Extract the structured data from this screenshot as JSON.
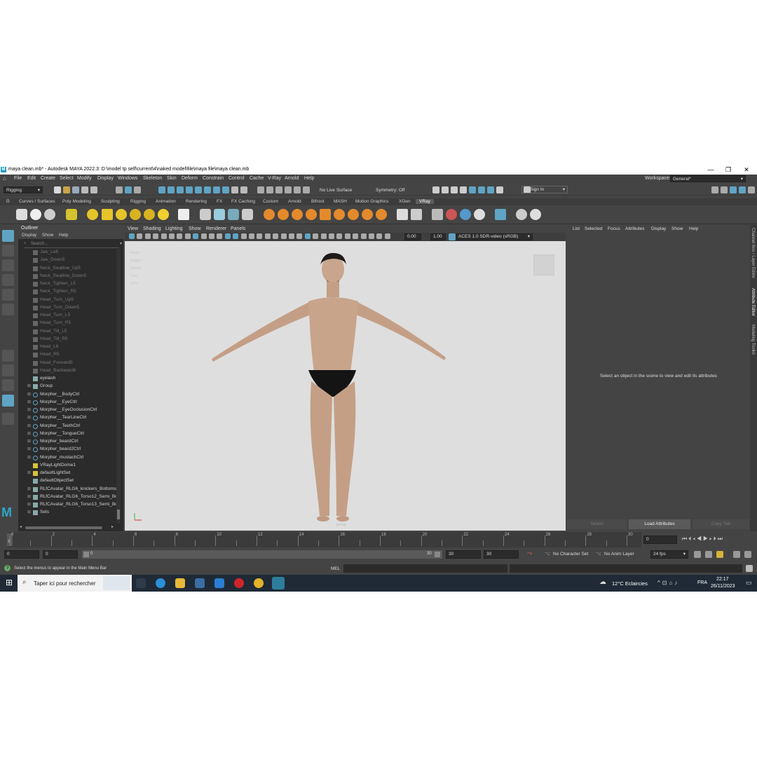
{
  "window": {
    "title": "maya clean.mb* - Autodesk MAYA 2022.3: D:\\model tp self\\current\\4\\naked model\\file\\maya file\\maya clean.mb",
    "logo_letter": "M",
    "minimize": "—",
    "restore": "❐",
    "close": "✕"
  },
  "menubar": {
    "items": [
      "File",
      "Edit",
      "Create",
      "Select",
      "Modify",
      "Display",
      "Windows",
      "Skeleton",
      "Skin",
      "Deform",
      "Constrain",
      "Control",
      "Cache",
      "V-Ray",
      "Arnold",
      "Help"
    ],
    "workspace_label": "Workspace:",
    "workspace_value": "General*"
  },
  "statusline": {
    "mode": "Rigging",
    "live_surface": "No Live Surface",
    "symmetry": "Symmetry: Off",
    "sign_in": "Sign In"
  },
  "shelf": {
    "tabs": [
      "Curves / Surfaces",
      "Poly Modeling",
      "Sculpting",
      "Rigging",
      "Animation",
      "Rendering",
      "FX",
      "FX Caching",
      "Custom",
      "Arnold",
      "Bifrost",
      "MASH",
      "Motion Graphics",
      "XGen",
      "VRay"
    ],
    "active_tab": "VRay"
  },
  "outliner": {
    "title": "Outliner",
    "menus": [
      "Display",
      "Show",
      "Help"
    ],
    "search_placeholder": "Search...",
    "items": [
      {
        "label": "Jaw_Left",
        "dim": true,
        "exp": false
      },
      {
        "label": "Jaw_Down5",
        "dim": true,
        "exp": false
      },
      {
        "label": "Neck_Swallow_Up5",
        "dim": true,
        "exp": false
      },
      {
        "label": "Neck_Swallow_Down5",
        "dim": true,
        "exp": false
      },
      {
        "label": "Neck_Tighten_L5",
        "dim": true,
        "exp": false
      },
      {
        "label": "Neck_Tighten_R5",
        "dim": true,
        "exp": false
      },
      {
        "label": "Head_Turn_Up5",
        "dim": true,
        "exp": false
      },
      {
        "label": "Head_Turn_Down5",
        "dim": true,
        "exp": false
      },
      {
        "label": "Head_Turn_L5",
        "dim": true,
        "exp": false
      },
      {
        "label": "Head_Turn_R5",
        "dim": true,
        "exp": false
      },
      {
        "label": "Head_Tilt_L5",
        "dim": true,
        "exp": false
      },
      {
        "label": "Head_Tilt_R5",
        "dim": true,
        "exp": false
      },
      {
        "label": "Head_L6",
        "dim": true,
        "exp": false
      },
      {
        "label": "Head_R5",
        "dim": true,
        "exp": false
      },
      {
        "label": "Head_Forward5",
        "dim": true,
        "exp": false
      },
      {
        "label": "Head_Backward6",
        "dim": true,
        "exp": false
      },
      {
        "label": "eyelash",
        "dim": false,
        "exp": false
      },
      {
        "label": "Group",
        "dim": false,
        "exp": true
      },
      {
        "label": "Morpher__BodyCtrl",
        "dim": false,
        "exp": true
      },
      {
        "label": "Morpher__EyeCtrl",
        "dim": false,
        "exp": true
      },
      {
        "label": "Morpher__EyeOcclusionCtrl",
        "dim": false,
        "exp": true
      },
      {
        "label": "Morpher__TearLineCtrl",
        "dim": false,
        "exp": true
      },
      {
        "label": "Morpher__TeethCtrl",
        "dim": false,
        "exp": true
      },
      {
        "label": "Morpher__TongueCtrl",
        "dim": false,
        "exp": true
      },
      {
        "label": "Morpher_beardCtrl",
        "dim": false,
        "exp": true
      },
      {
        "label": "Morpher_beard2Ctrl",
        "dim": false,
        "exp": true
      },
      {
        "label": "Morpher_mustachCtrl",
        "dim": false,
        "exp": true
      },
      {
        "label": "VRayLightDome1",
        "dim": false,
        "exp": false
      },
      {
        "label": "defaultLightSet",
        "dim": false,
        "exp": true
      },
      {
        "label": "defaultObjectSet",
        "dim": false,
        "exp": false
      },
      {
        "label": "RLfCAvatar_RLG6_knickers_Bottoms",
        "dim": false,
        "exp": true
      },
      {
        "label": "RLfCAvatar_RLG6_Torso12_Semi_Bottc",
        "dim": false,
        "exp": true
      },
      {
        "label": "RLfCAvatar_RLG6_Torso13_Semi_Bottc",
        "dim": false,
        "exp": true
      },
      {
        "label": "Sets",
        "dim": false,
        "exp": true
      }
    ]
  },
  "viewport": {
    "menus": [
      "View",
      "Shading",
      "Lighting",
      "Show",
      "Renderer",
      "Panels"
    ],
    "exposure": "0.00",
    "gamma": "1.00",
    "color_space": "ACES 1.0 SDR-video (sRGB)",
    "hud_rows": [
      "Verts:",
      "Edges:",
      "Faces:",
      "Tris:",
      "UVs:"
    ],
    "camera_label": "persp"
  },
  "attribute_editor": {
    "menus": [
      "List",
      "Selected",
      "Focus",
      "Attributes",
      "Display",
      "Show",
      "Help"
    ],
    "message": "Select an object in the scene to view and edit its attributes",
    "footer": {
      "select": "Select",
      "load": "Load Attributes",
      "copy": "Copy Tab"
    },
    "side_tabs": [
      "Channel Box / Layer Editor",
      "Attribute Editor",
      "Modeling Toolkit"
    ]
  },
  "timeline": {
    "ticks": [
      0,
      2,
      4,
      6,
      8,
      10,
      12,
      14,
      16,
      18,
      20,
      22,
      24,
      26,
      28,
      30
    ],
    "current_frame": "0",
    "frame_field": "0"
  },
  "range": {
    "start": "0",
    "start2": "0",
    "slider_start": "0",
    "slider_end": "30",
    "end": "30",
    "end2": "30",
    "character_set": "No Character Set",
    "anim_layer": "No Anim Layer",
    "fps": "24 fps"
  },
  "command": {
    "help_text": "Select the menus to appear in the Main Menu Bar",
    "lang": "MEL"
  },
  "taskbar": {
    "search_placeholder": "Taper ici pour rechercher",
    "weather": "12°C  Eclaircies",
    "lang": "FRA",
    "time": "22:17",
    "date": "26/11/2023"
  },
  "colors": {
    "maya_blue": "#5fa4c4",
    "active_tab": "#5d5d5d",
    "taskbar": "#1f2a36"
  }
}
